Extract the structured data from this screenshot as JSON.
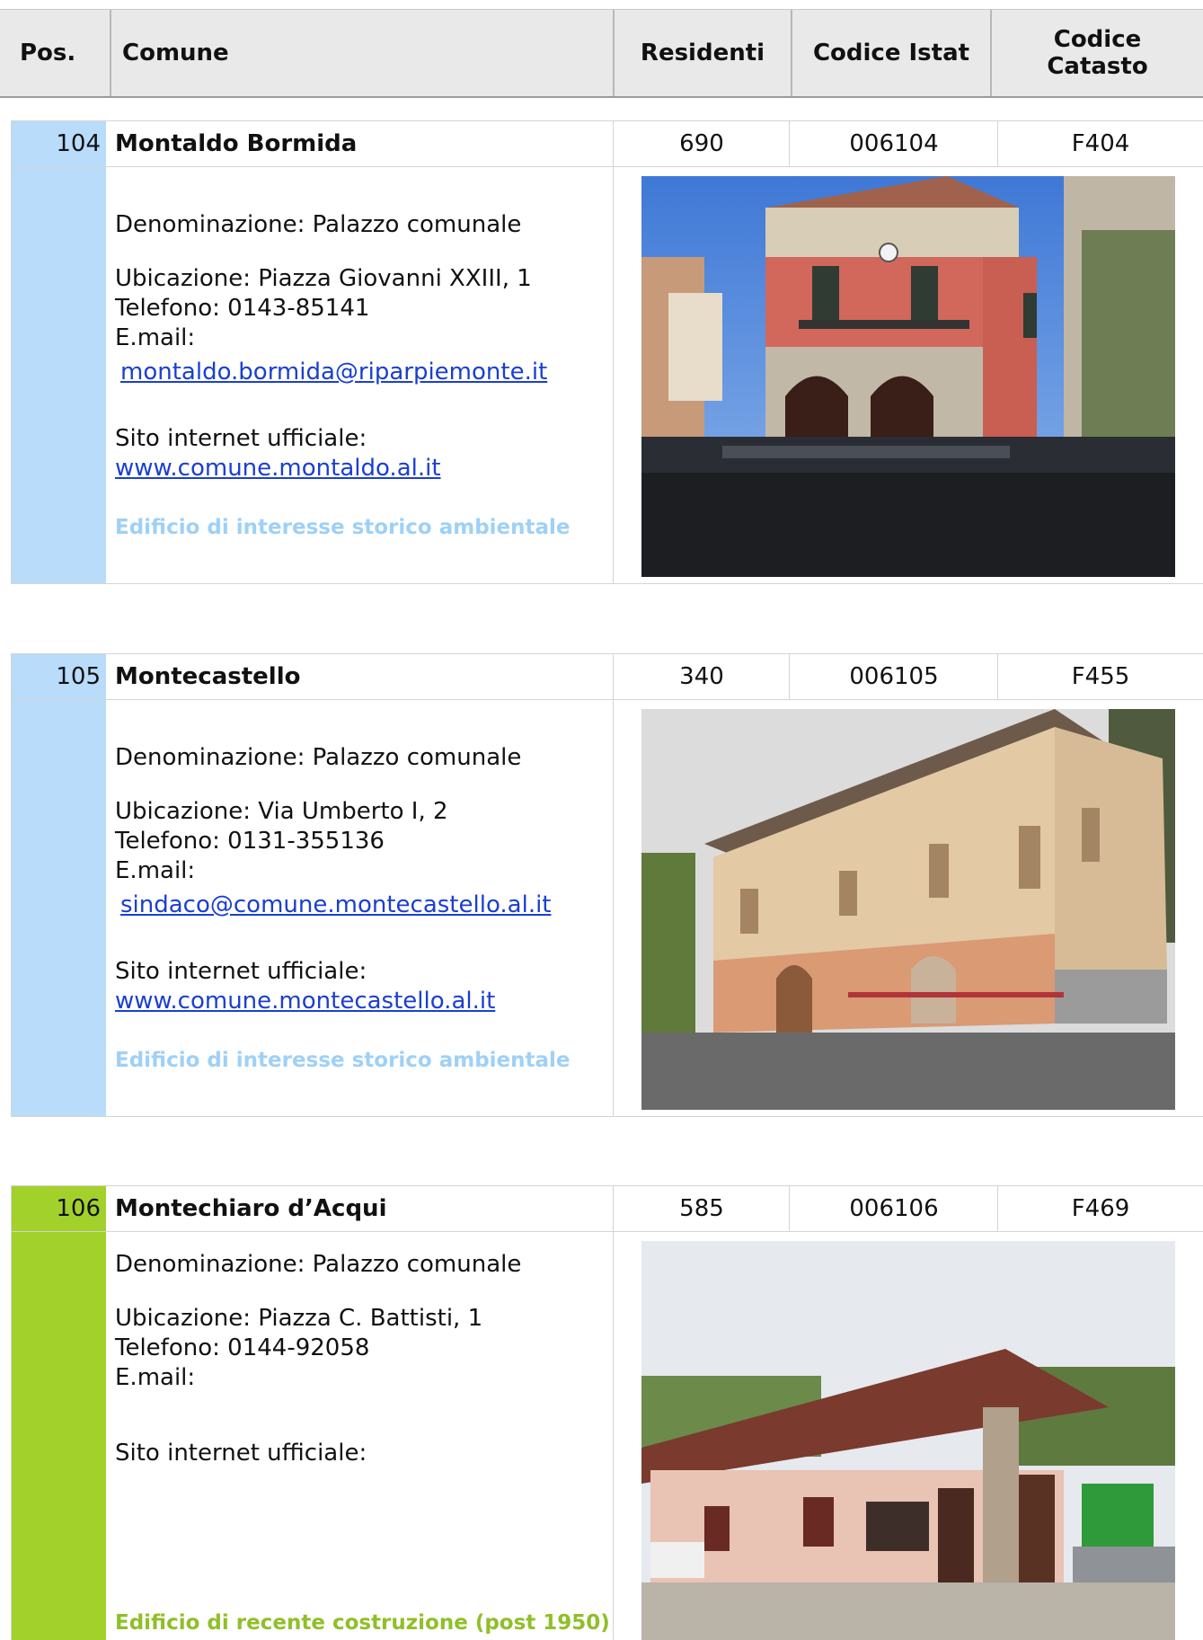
{
  "header": {
    "pos": "Pos.",
    "comune": "Comune",
    "residenti": "Residenti",
    "istat": "Codice Istat",
    "catasto_line1": "Codice",
    "catasto_line2": "Catasto"
  },
  "colors": {
    "historic_band": "#b8dcfa",
    "historic_note": "#9fd0f7",
    "recent_band": "#a3d12c",
    "recent_note": "#8fc028",
    "link": "#1a3fd0"
  },
  "records": [
    {
      "pos": "104",
      "name": "Montaldo Bormida",
      "residenti": "690",
      "istat": "006104",
      "catasto": "F404",
      "denominazione": "Denominazione: Palazzo comunale",
      "ubicazione": "Ubicazione: Piazza Giovanni XXIII, 1",
      "telefono": "Telefono: 0143-85141",
      "email_label": "E.mail:",
      "email": "montaldo.bormida@riparpiemonte.it",
      "sito_label": "Sito internet ufficiale:",
      "sito": "www.comune.montaldo.al.it",
      "note": "Edificio di interesse storico ambientale"
    },
    {
      "pos": "105",
      "name": "Montecastello",
      "residenti": "340",
      "istat": "006105",
      "catasto": "F455",
      "denominazione": "Denominazione: Palazzo comunale",
      "ubicazione": "Ubicazione: Via Umberto I, 2",
      "telefono": "Telefono: 0131-355136",
      "email_label": "E.mail:",
      "email": "sindaco@comune.montecastello.al.it",
      "sito_label": "Sito internet ufficiale:",
      "sito": "www.comune.montecastello.al.it",
      "note": "Edificio di interesse storico ambientale"
    },
    {
      "pos": "106",
      "name": "Montechiaro d’Acqui",
      "residenti": "585",
      "istat": "006106",
      "catasto": "F469",
      "denominazione": "Denominazione: Palazzo comunale",
      "ubicazione": "Ubicazione: Piazza C. Battisti, 1",
      "telefono": "Telefono: 0144-92058",
      "email_label": "E.mail:",
      "sito_label": "Sito internet ufficiale:",
      "note": "Edificio di recente costruzione (post 1950)"
    }
  ]
}
